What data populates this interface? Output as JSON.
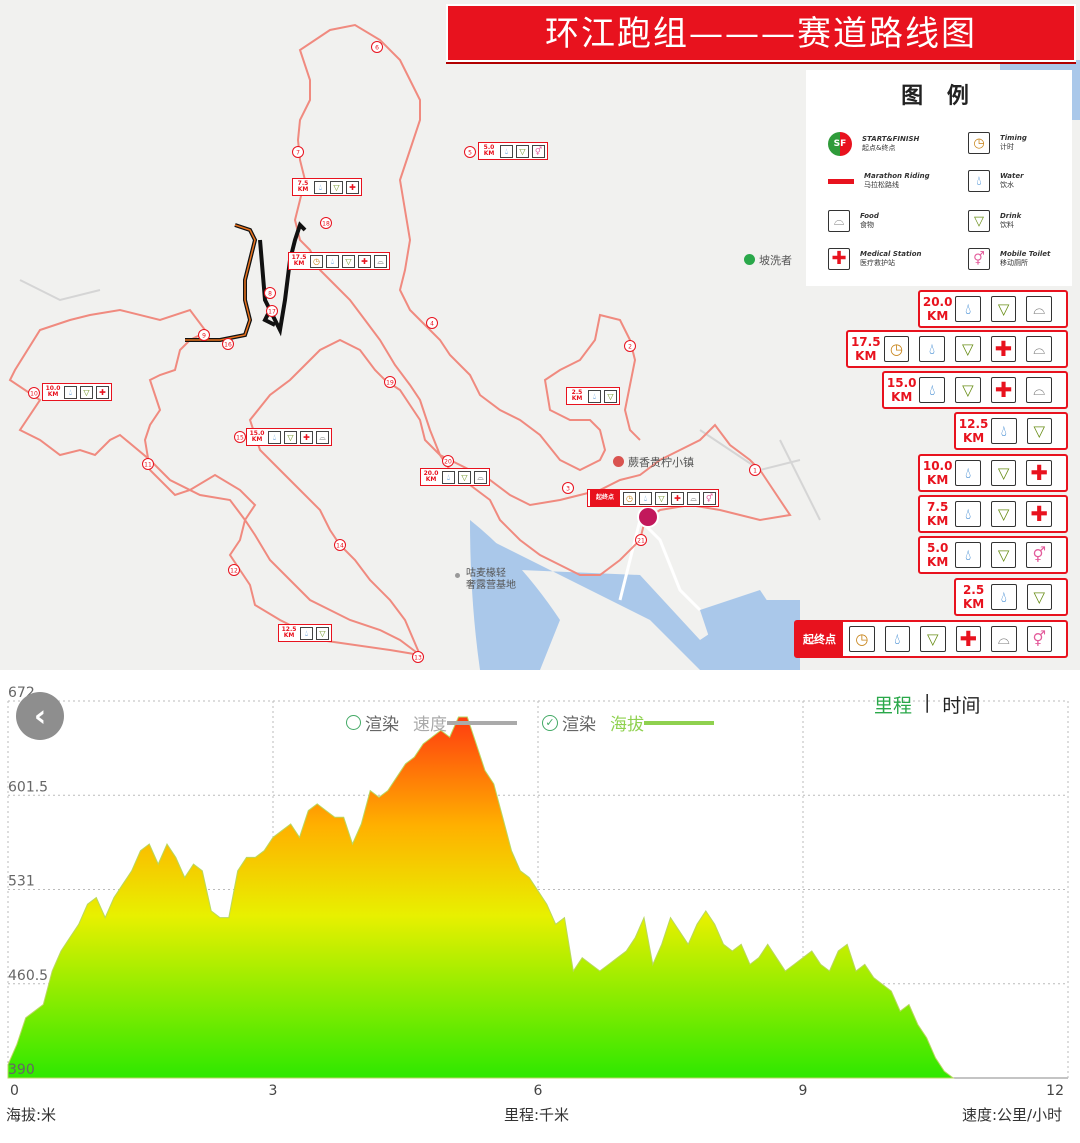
{
  "map": {
    "title": "环江跑组———赛道路线图",
    "legend": {
      "title": "图 例",
      "items": [
        {
          "id": "start-finish",
          "en": "START&FINISH",
          "zh": "起点&终点",
          "icon": "sf-badge-icon"
        },
        {
          "id": "timing",
          "en": "Timing",
          "zh": "计时",
          "icon": "timing-icon"
        },
        {
          "id": "route",
          "en": "Marathon Riding",
          "zh": "马拉松路线",
          "icon": "red-line-icon"
        },
        {
          "id": "water",
          "en": "Water",
          "zh": "饮水",
          "icon": "water-drop-icon"
        },
        {
          "id": "food",
          "en": "Food",
          "zh": "食物",
          "icon": "food-cloche-icon"
        },
        {
          "id": "drink",
          "en": "Drink",
          "zh": "饮料",
          "icon": "drink-cup-icon"
        },
        {
          "id": "medical",
          "en": "Medical Station",
          "zh": "医疗救护站",
          "icon": "medical-cross-icon"
        },
        {
          "id": "toilet",
          "en": "Mobile Toilet",
          "zh": "移动厕所",
          "icon": "toilet-icon"
        }
      ]
    },
    "stations": [
      {
        "km": "20.0\nKM",
        "icons": [
          "water",
          "drink",
          "food"
        ]
      },
      {
        "km": "17.5\nKM",
        "icons": [
          "timing",
          "water",
          "drink",
          "med",
          "food"
        ]
      },
      {
        "km": "15.0\nKM",
        "icons": [
          "water",
          "drink",
          "med",
          "food"
        ]
      },
      {
        "km": "12.5\nKM",
        "icons": [
          "water",
          "drink"
        ]
      },
      {
        "km": "10.0\nKM",
        "icons": [
          "water",
          "drink",
          "med"
        ]
      },
      {
        "km": "7.5\nKM",
        "icons": [
          "water",
          "drink",
          "med"
        ]
      },
      {
        "km": "5.0\nKM",
        "icons": [
          "water",
          "drink",
          "toilet"
        ]
      },
      {
        "km": "2.5\nKM",
        "icons": [
          "water",
          "drink"
        ]
      },
      {
        "km": "起终点",
        "icons": [
          "timing",
          "water",
          "drink",
          "med",
          "food",
          "toilet"
        ]
      }
    ],
    "mini_stations": [
      {
        "km": "5.0\nKM",
        "icons": [
          "water",
          "drink",
          "toilet"
        ]
      },
      {
        "km": "7.5\nKM",
        "icons": [
          "water",
          "drink",
          "med"
        ]
      },
      {
        "km": "17.5\nKM",
        "icons": [
          "timing",
          "water",
          "drink",
          "med",
          "food"
        ]
      },
      {
        "km": "10.0\nKM",
        "icons": [
          "water",
          "drink",
          "med"
        ]
      },
      {
        "km": "15.0\nKM",
        "icons": [
          "water",
          "drink",
          "med",
          "food"
        ]
      },
      {
        "km": "20.0\nKM",
        "icons": [
          "water",
          "drink",
          "food"
        ]
      },
      {
        "km": "2.5\nKM",
        "icons": [
          "water",
          "drink"
        ]
      },
      {
        "km": "12.5\nKM",
        "icons": [
          "water",
          "drink"
        ]
      },
      {
        "km": "起终点",
        "icons": [
          "timing",
          "water",
          "drink",
          "med",
          "food",
          "toilet"
        ]
      }
    ],
    "pois": [
      {
        "name": "坡洗者",
        "color": "#2aa84a"
      },
      {
        "name": "蕨香贵柠小镇",
        "color": "#d9534f"
      },
      {
        "name": "咕麦椽轻\n奢露营基地",
        "color": "#999999"
      }
    ],
    "kilometer_markers": [
      "1",
      "2",
      "3",
      "4",
      "5",
      "6",
      "7",
      "8",
      "9",
      "10",
      "11",
      "12",
      "13",
      "14",
      "15",
      "16",
      "17",
      "18",
      "19",
      "20",
      "21"
    ]
  },
  "chart": {
    "back_icon": "chevron-left-icon",
    "legend": [
      {
        "label": "渲染",
        "series": "速度",
        "checked": false,
        "color": "#aaaaaa"
      },
      {
        "label": "渲染",
        "series": "海拔",
        "checked": true,
        "color": "#8fd14f"
      }
    ],
    "toggle": {
      "active": "里程",
      "separator": "|",
      "inactive": "时间"
    },
    "x_axis_title": "里程:千米",
    "y_axis_title": "海拔:米",
    "right_axis_title": "速度:公里/小时",
    "chart_data": {
      "type": "area",
      "xlabel": "里程:千米",
      "ylabel": "海拔:米",
      "xlim": [
        0,
        12
      ],
      "ylim": [
        390,
        672
      ],
      "x_ticks": [
        "0",
        "3",
        "6",
        "9",
        "12"
      ],
      "y_ticks": [
        "390",
        "460.5",
        "531",
        "601.5",
        "672"
      ],
      "series": [
        {
          "name": "海拔",
          "x": [
            0,
            0.1,
            0.2,
            0.3,
            0.4,
            0.5,
            0.6,
            0.7,
            0.8,
            0.9,
            1.0,
            1.1,
            1.2,
            1.3,
            1.4,
            1.5,
            1.6,
            1.7,
            1.8,
            1.9,
            2.0,
            2.1,
            2.2,
            2.3,
            2.4,
            2.5,
            2.6,
            2.7,
            2.8,
            2.9,
            3.0,
            3.1,
            3.2,
            3.3,
            3.4,
            3.5,
            3.6,
            3.7,
            3.8,
            3.9,
            4.0,
            4.1,
            4.2,
            4.3,
            4.4,
            4.5,
            4.6,
            4.7,
            4.8,
            4.9,
            5.0,
            5.1,
            5.2,
            5.3,
            5.4,
            5.5,
            5.6,
            5.7,
            5.8,
            5.9,
            6.0,
            6.1,
            6.2,
            6.3,
            6.4,
            6.5,
            6.6,
            6.7,
            6.8,
            6.9,
            7.0,
            7.1,
            7.2,
            7.3,
            7.4,
            7.5,
            7.6,
            7.7,
            7.8,
            7.9,
            8.0,
            8.1,
            8.2,
            8.3,
            8.4,
            8.5,
            8.6,
            8.7,
            8.8,
            8.9,
            9.0,
            9.1,
            9.2,
            9.3,
            9.4,
            9.5,
            9.6,
            9.7,
            9.8,
            9.9,
            10.0,
            10.1,
            10.2,
            10.3,
            10.4,
            10.5,
            10.6,
            10.7
          ],
          "values": [
            400,
            415,
            435,
            440,
            445,
            470,
            485,
            495,
            505,
            520,
            525,
            510,
            525,
            535,
            545,
            560,
            565,
            550,
            565,
            555,
            540,
            550,
            545,
            515,
            510,
            510,
            545,
            555,
            555,
            560,
            570,
            575,
            580,
            570,
            590,
            595,
            590,
            585,
            585,
            565,
            580,
            605,
            600,
            605,
            615,
            625,
            630,
            640,
            645,
            650,
            645,
            660,
            660,
            640,
            620,
            610,
            585,
            560,
            545,
            540,
            530,
            520,
            505,
            510,
            470,
            480,
            475,
            470,
            475,
            480,
            485,
            495,
            510,
            475,
            490,
            510,
            500,
            490,
            505,
            515,
            505,
            490,
            485,
            490,
            475,
            480,
            490,
            480,
            470,
            475,
            480,
            485,
            475,
            470,
            485,
            490,
            470,
            475,
            465,
            460,
            455,
            440,
            445,
            430,
            420,
            405,
            395,
            390
          ]
        }
      ]
    }
  }
}
